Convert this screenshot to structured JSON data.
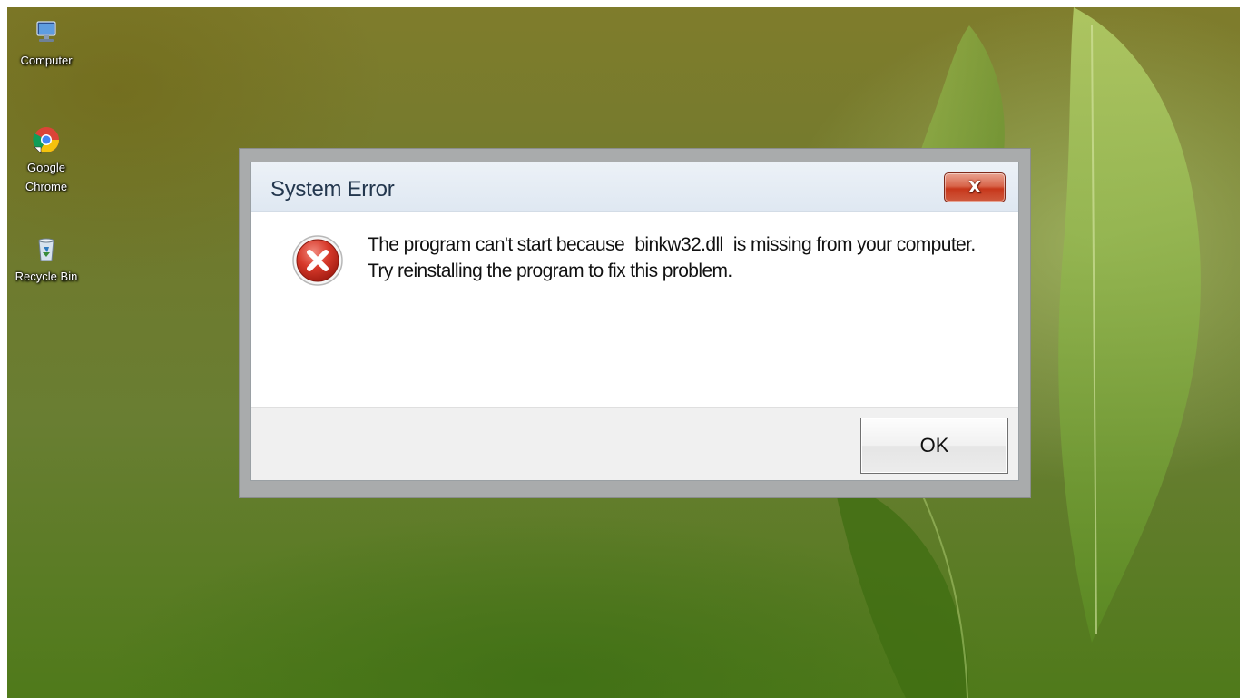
{
  "desktop": {
    "icons": [
      {
        "label": "Computer",
        "icon": "computer-icon"
      },
      {
        "label": "Google\nChrome",
        "icon": "chrome-icon"
      },
      {
        "label": "Recycle Bin",
        "icon": "recycle-bin-icon"
      }
    ]
  },
  "dialog": {
    "title": "System Error",
    "close_label": "X",
    "message_part1": "The program can't start because",
    "missing_file": "binkw32.dll",
    "message_part2": "is missing from your computer. Try reinstalling the program to fix this problem.",
    "ok_label": "OK",
    "icon": "error-icon"
  },
  "colors": {
    "error_red": "#c62828",
    "close_button": "#c7371b",
    "titlebar": "#dfe8f2"
  }
}
